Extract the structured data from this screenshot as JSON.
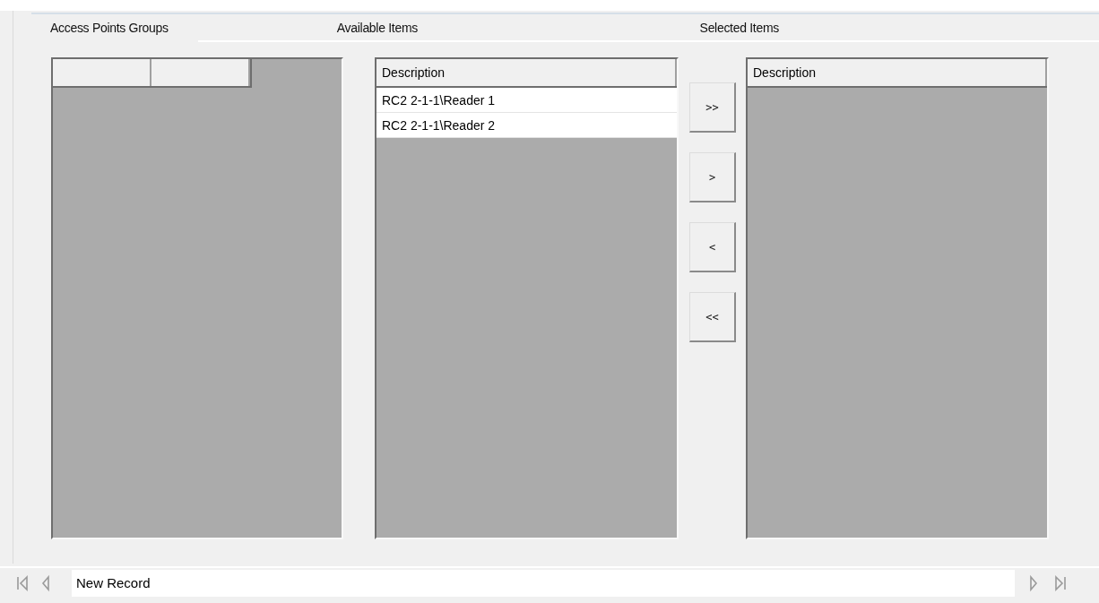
{
  "sections": [
    {
      "title": "Access Points Groups",
      "kind": "tab"
    },
    {
      "title": "Available Items",
      "kind": "label"
    },
    {
      "title": "Selected Items",
      "kind": "label"
    }
  ],
  "groups_grid": {
    "columns": [
      {
        "kind": "blank"
      },
      {
        "kind": "blank"
      }
    ]
  },
  "available_items": {
    "column": "Description",
    "rows": [
      "RC2 2-1-1\\Reader 1",
      "RC2 2-1-1\\Reader 2"
    ]
  },
  "transfer_buttons": [
    ">>",
    ">",
    "<",
    "<<"
  ],
  "selected_items": {
    "column": "Description"
  },
  "navigator": {
    "record": "New Record"
  }
}
